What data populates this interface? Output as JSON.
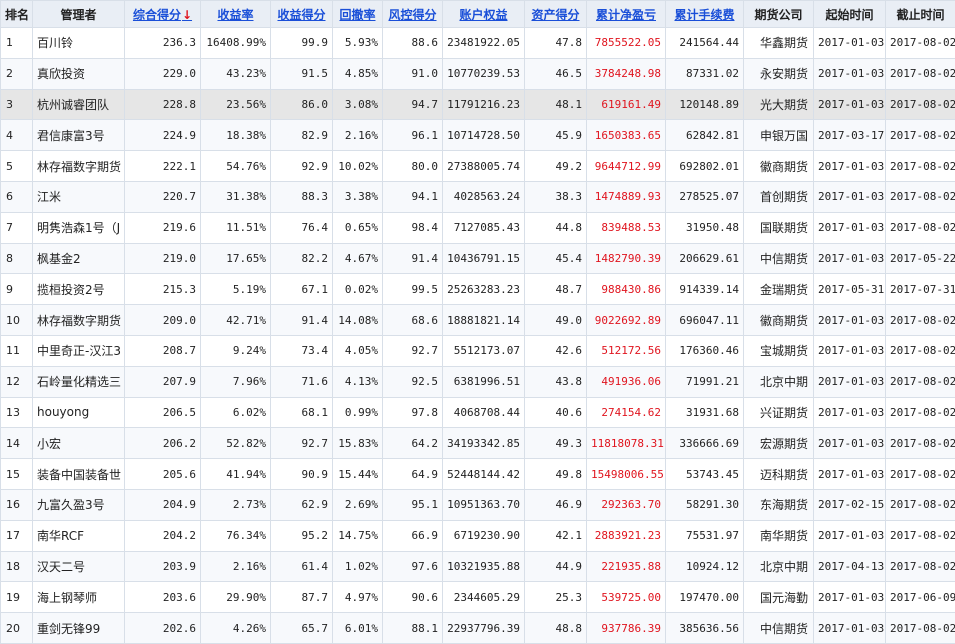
{
  "colors": {
    "link": "#1a4fd8",
    "red": "#e0141e",
    "header_bg": "#e9eef5",
    "highlight_row": "#e6e6e6"
  },
  "header": {
    "rank": "排名",
    "manager": "管理者",
    "score": "综合得分",
    "sort_arrow": "↓",
    "return": "收益率",
    "return_score": "收益得分",
    "drawdown": "回撤率",
    "risk_score": "风控得分",
    "equity": "账户权益",
    "asset_score": "资产得分",
    "pnl": "累计净盈亏",
    "fee": "累计手续费",
    "company": "期货公司",
    "start": "起始时间",
    "end": "截止时间"
  },
  "rows": [
    {
      "rank": "1",
      "manager": "百川铃",
      "score": "236.3",
      "return": "16408.99%",
      "return_score": "99.9",
      "drawdown": "5.93%",
      "risk_score": "88.6",
      "equity": "23481922.05",
      "asset_score": "47.8",
      "pnl": "7855522.05",
      "fee": "241564.44",
      "company": "华鑫期货",
      "start": "2017-01-03",
      "end": "2017-08-02"
    },
    {
      "rank": "2",
      "manager": "真欣投资",
      "score": "229.0",
      "return": "43.23%",
      "return_score": "91.5",
      "drawdown": "4.85%",
      "risk_score": "91.0",
      "equity": "10770239.53",
      "asset_score": "46.5",
      "pnl": "3784248.98",
      "fee": "87331.02",
      "company": "永安期货",
      "start": "2017-01-03",
      "end": "2017-08-02"
    },
    {
      "rank": "3",
      "manager": "杭州诚睿团队",
      "score": "228.8",
      "return": "23.56%",
      "return_score": "86.0",
      "drawdown": "3.08%",
      "risk_score": "94.7",
      "equity": "11791216.23",
      "asset_score": "48.1",
      "pnl": "619161.49",
      "fee": "120148.89",
      "company": "光大期货",
      "start": "2017-01-03",
      "end": "2017-08-02"
    },
    {
      "rank": "4",
      "manager": "君信康富3号",
      "score": "224.9",
      "return": "18.38%",
      "return_score": "82.9",
      "drawdown": "2.16%",
      "risk_score": "96.1",
      "equity": "10714728.50",
      "asset_score": "45.9",
      "pnl": "1650383.65",
      "fee": "62842.81",
      "company": "申银万国",
      "start": "2017-03-17",
      "end": "2017-08-02"
    },
    {
      "rank": "5",
      "manager": "林存福数字期货",
      "score": "222.1",
      "return": "54.76%",
      "return_score": "92.9",
      "drawdown": "10.02%",
      "risk_score": "80.0",
      "equity": "27388005.74",
      "asset_score": "49.2",
      "pnl": "9644712.99",
      "fee": "692802.01",
      "company": "徽商期货",
      "start": "2017-01-03",
      "end": "2017-08-02"
    },
    {
      "rank": "6",
      "manager": "江米",
      "score": "220.7",
      "return": "31.38%",
      "return_score": "88.3",
      "drawdown": "3.38%",
      "risk_score": "94.1",
      "equity": "4028563.24",
      "asset_score": "38.3",
      "pnl": "1474889.93",
      "fee": "278525.07",
      "company": "首创期货",
      "start": "2017-01-03",
      "end": "2017-08-02"
    },
    {
      "rank": "7",
      "manager": "明隽浩森1号（J",
      "score": "219.6",
      "return": "11.51%",
      "return_score": "76.4",
      "drawdown": "0.65%",
      "risk_score": "98.4",
      "equity": "7127085.43",
      "asset_score": "44.8",
      "pnl": "839488.53",
      "fee": "31950.48",
      "company": "国联期货",
      "start": "2017-01-03",
      "end": "2017-08-02"
    },
    {
      "rank": "8",
      "manager": "枫基金2",
      "score": "219.0",
      "return": "17.65%",
      "return_score": "82.2",
      "drawdown": "4.67%",
      "risk_score": "91.4",
      "equity": "10436791.15",
      "asset_score": "45.4",
      "pnl": "1482790.39",
      "fee": "206629.61",
      "company": "中信期货",
      "start": "2017-01-03",
      "end": "2017-05-22"
    },
    {
      "rank": "9",
      "manager": "揽桓投资2号",
      "score": "215.3",
      "return": "5.19%",
      "return_score": "67.1",
      "drawdown": "0.02%",
      "risk_score": "99.5",
      "equity": "25263283.23",
      "asset_score": "48.7",
      "pnl": "988430.86",
      "fee": "914339.14",
      "company": "金瑞期货",
      "start": "2017-05-31",
      "end": "2017-07-31"
    },
    {
      "rank": "10",
      "manager": "林存福数字期货",
      "score": "209.0",
      "return": "42.71%",
      "return_score": "91.4",
      "drawdown": "14.08%",
      "risk_score": "68.6",
      "equity": "18881821.14",
      "asset_score": "49.0",
      "pnl": "9022692.89",
      "fee": "696047.11",
      "company": "徽商期货",
      "start": "2017-01-03",
      "end": "2017-08-02"
    },
    {
      "rank": "11",
      "manager": "中里奇正-汉江3",
      "score": "208.7",
      "return": "9.24%",
      "return_score": "73.4",
      "drawdown": "4.05%",
      "risk_score": "92.7",
      "equity": "5512173.07",
      "asset_score": "42.6",
      "pnl": "512172.56",
      "fee": "176360.46",
      "company": "宝城期货",
      "start": "2017-01-03",
      "end": "2017-08-02"
    },
    {
      "rank": "12",
      "manager": "石岭量化精选三",
      "score": "207.9",
      "return": "7.96%",
      "return_score": "71.6",
      "drawdown": "4.13%",
      "risk_score": "92.5",
      "equity": "6381996.51",
      "asset_score": "43.8",
      "pnl": "491936.06",
      "fee": "71991.21",
      "company": "北京中期",
      "start": "2017-01-03",
      "end": "2017-08-02"
    },
    {
      "rank": "13",
      "manager": "houyong",
      "score": "206.5",
      "return": "6.02%",
      "return_score": "68.1",
      "drawdown": "0.99%",
      "risk_score": "97.8",
      "equity": "4068708.44",
      "asset_score": "40.6",
      "pnl": "274154.62",
      "fee": "31931.68",
      "company": "兴证期货",
      "start": "2017-01-03",
      "end": "2017-08-02"
    },
    {
      "rank": "14",
      "manager": "小宏",
      "score": "206.2",
      "return": "52.82%",
      "return_score": "92.7",
      "drawdown": "15.83%",
      "risk_score": "64.2",
      "equity": "34193342.85",
      "asset_score": "49.3",
      "pnl": "11818078.31",
      "fee": "336666.69",
      "company": "宏源期货",
      "start": "2017-01-03",
      "end": "2017-08-02"
    },
    {
      "rank": "15",
      "manager": "装备中国装备世",
      "score": "205.6",
      "return": "41.94%",
      "return_score": "90.9",
      "drawdown": "15.44%",
      "risk_score": "64.9",
      "equity": "52448144.42",
      "asset_score": "49.8",
      "pnl": "15498006.55",
      "fee": "53743.45",
      "company": "迈科期货",
      "start": "2017-01-03",
      "end": "2017-08-02"
    },
    {
      "rank": "16",
      "manager": "九富久盈3号",
      "score": "204.9",
      "return": "2.73%",
      "return_score": "62.9",
      "drawdown": "2.69%",
      "risk_score": "95.1",
      "equity": "10951363.70",
      "asset_score": "46.9",
      "pnl": "292363.70",
      "fee": "58291.30",
      "company": "东海期货",
      "start": "2017-02-15",
      "end": "2017-08-02"
    },
    {
      "rank": "17",
      "manager": "南华RCF",
      "score": "204.2",
      "return": "76.34%",
      "return_score": "95.2",
      "drawdown": "14.75%",
      "risk_score": "66.9",
      "equity": "6719230.90",
      "asset_score": "42.1",
      "pnl": "2883921.23",
      "fee": "75531.97",
      "company": "南华期货",
      "start": "2017-01-03",
      "end": "2017-08-02"
    },
    {
      "rank": "18",
      "manager": "汉天二号",
      "score": "203.9",
      "return": "2.16%",
      "return_score": "61.4",
      "drawdown": "1.02%",
      "risk_score": "97.6",
      "equity": "10321935.88",
      "asset_score": "44.9",
      "pnl": "221935.88",
      "fee": "10924.12",
      "company": "北京中期",
      "start": "2017-04-13",
      "end": "2017-08-02"
    },
    {
      "rank": "19",
      "manager": "海上钢琴师",
      "score": "203.6",
      "return": "29.90%",
      "return_score": "87.7",
      "drawdown": "4.97%",
      "risk_score": "90.6",
      "equity": "2344605.29",
      "asset_score": "25.3",
      "pnl": "539725.00",
      "fee": "197470.00",
      "company": "国元海勤",
      "start": "2017-01-03",
      "end": "2017-06-09"
    },
    {
      "rank": "20",
      "manager": "重剑无锋99",
      "score": "202.6",
      "return": "4.26%",
      "return_score": "65.7",
      "drawdown": "6.01%",
      "risk_score": "88.1",
      "equity": "22937796.39",
      "asset_score": "48.8",
      "pnl": "937786.39",
      "fee": "385636.56",
      "company": "中信期货",
      "start": "2017-01-03",
      "end": "2017-08-02"
    }
  ]
}
